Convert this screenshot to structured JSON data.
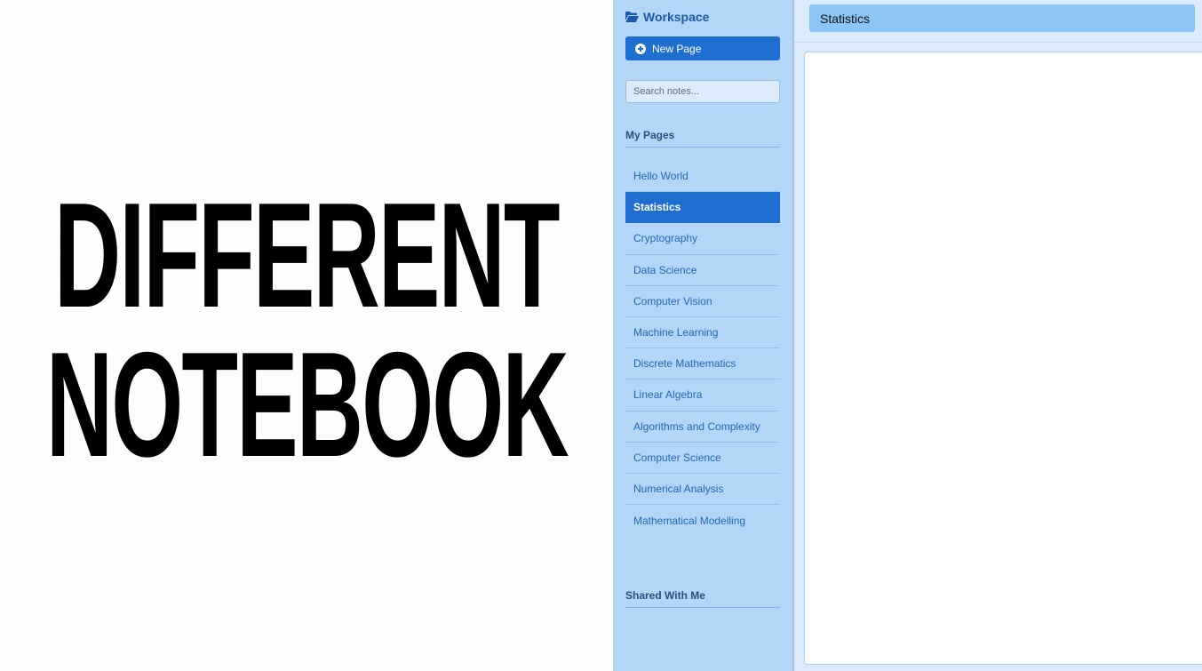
{
  "headline": {
    "line1": "DIFFERENT",
    "line2": "NOTEBOOK"
  },
  "sidebar": {
    "workspace_title": "Workspace",
    "workspace_icon": "folder-open-icon",
    "new_page_label": "New Page",
    "new_page_icon": "plus-circle-icon",
    "search_placeholder": "Search notes...",
    "my_pages_heading": "My Pages",
    "pages": [
      {
        "label": "Hello World",
        "active": false
      },
      {
        "label": "Statistics",
        "active": true
      },
      {
        "label": "Cryptography",
        "active": false
      },
      {
        "label": "Data Science",
        "active": false
      },
      {
        "label": "Computer Vision",
        "active": false
      },
      {
        "label": "Machine Learning",
        "active": false
      },
      {
        "label": "Discrete Mathematics",
        "active": false
      },
      {
        "label": "Linear Algebra",
        "active": false
      },
      {
        "label": "Algorithms and Complexity",
        "active": false
      },
      {
        "label": "Computer Science",
        "active": false
      },
      {
        "label": "Numerical Analysis",
        "active": false
      },
      {
        "label": "Mathematical Modelling",
        "active": false
      }
    ],
    "shared_heading": "Shared With Me"
  },
  "main": {
    "page_title": "Statistics"
  },
  "colors": {
    "accent": "#1f6fd1",
    "sidebar_bg": "#b4d6f6",
    "header_bg": "#8cc4f5"
  }
}
